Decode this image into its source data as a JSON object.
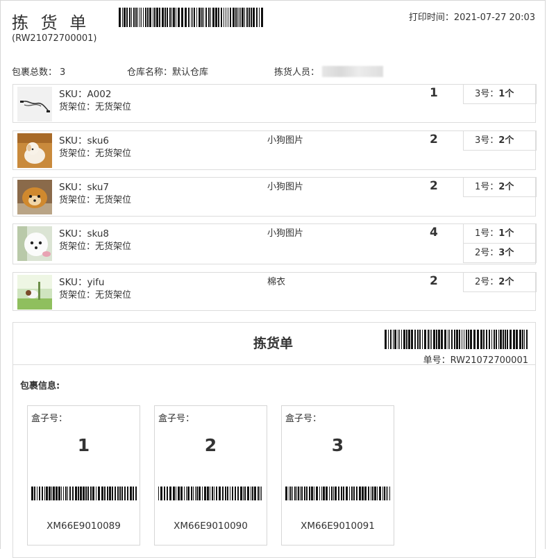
{
  "header": {
    "title": "拣 货 单",
    "order_no_paren": "(RW21072700001)",
    "print_time": "打印时间：2021-07-27 20:03"
  },
  "summary": {
    "total_label": "包裹总数：",
    "total_value": "3",
    "warehouse_label": "仓库名称：",
    "warehouse_value": "默认仓库",
    "picker_label": "拣货人员："
  },
  "items": [
    {
      "sku": "SKU：A002",
      "shelf": "货架位：无货架位",
      "name": "",
      "qty": "1",
      "boxes": [
        {
          "label": "3号：",
          "count": "1个"
        }
      ],
      "thumb": "cable-image"
    },
    {
      "sku": "SKU：sku6",
      "shelf": "货架位：无货架位",
      "name": "小狗图片",
      "qty": "2",
      "boxes": [
        {
          "label": "3号：",
          "count": "2个"
        }
      ],
      "thumb": "puppy-image"
    },
    {
      "sku": "SKU：sku7",
      "shelf": "货架位：无货架位",
      "name": "小狗图片",
      "qty": "2",
      "boxes": [
        {
          "label": "1号：",
          "count": "2个"
        }
      ],
      "thumb": "puppy-image"
    },
    {
      "sku": "SKU：sku8",
      "shelf": "货架位：无货架位",
      "name": "小狗图片",
      "qty": "4",
      "boxes": [
        {
          "label": "1号：",
          "count": "1个"
        },
        {
          "label": "2号：",
          "count": "3个"
        }
      ],
      "thumb": "puppy-image"
    },
    {
      "sku": "SKU：yifu",
      "shelf": "货架位：无货架位",
      "name": "棉衣",
      "qty": "2",
      "boxes": [
        {
          "label": "2号：",
          "count": "2个"
        }
      ],
      "thumb": "garden-image"
    }
  ],
  "slip": {
    "title": "拣货单",
    "order_no": "单号：RW21072700001",
    "package_info_label": "包裹信息:",
    "packages": [
      {
        "box_label": "盒子号：",
        "box_number": "1",
        "code": "XM66E9010089"
      },
      {
        "box_label": "盒子号：",
        "box_number": "2",
        "code": "XM66E9010090"
      },
      {
        "box_label": "盒子号：",
        "box_number": "3",
        "code": "XM66E9010091"
      }
    ]
  }
}
